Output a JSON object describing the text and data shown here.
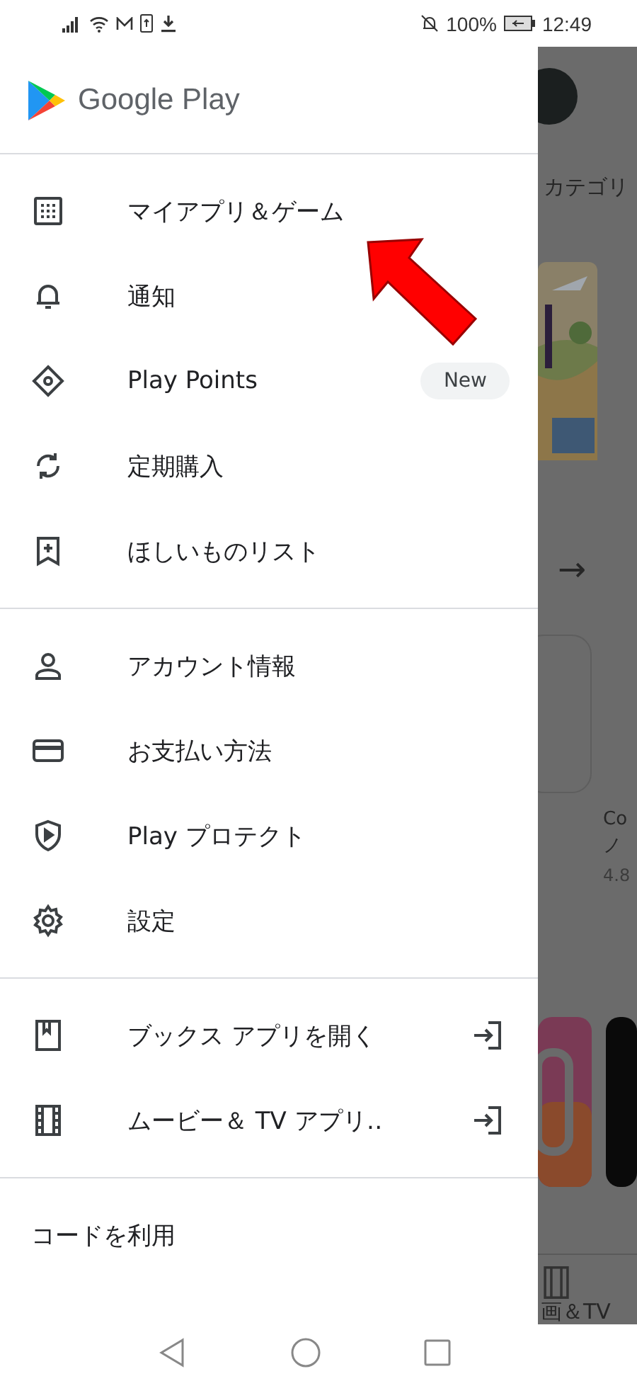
{
  "status_bar": {
    "battery": "100%",
    "time": "12:49"
  },
  "drawer": {
    "title": "Google Play",
    "sections": [
      [
        {
          "label": "マイアプリ＆ゲーム"
        },
        {
          "label": "通知"
        },
        {
          "label": "Play Points",
          "badge": "New"
        },
        {
          "label": "定期購入"
        },
        {
          "label": "ほしいものリスト"
        }
      ],
      [
        {
          "label": "アカウント情報"
        },
        {
          "label": "お支払い方法"
        },
        {
          "label": "Play プロテクト"
        },
        {
          "label": "設定"
        }
      ],
      [
        {
          "label": "ブックス アプリを開く",
          "external": true
        },
        {
          "label": "ムービー＆ TV アプリ‥",
          "external": true
        }
      ],
      [
        {
          "label": "コードを利用"
        }
      ]
    ]
  },
  "background": {
    "category": "カテゴリ",
    "arrow": "→",
    "app_title": "Co",
    "app_subtitle": "ノ",
    "rating": "4.8",
    "tab": "画＆TV"
  }
}
